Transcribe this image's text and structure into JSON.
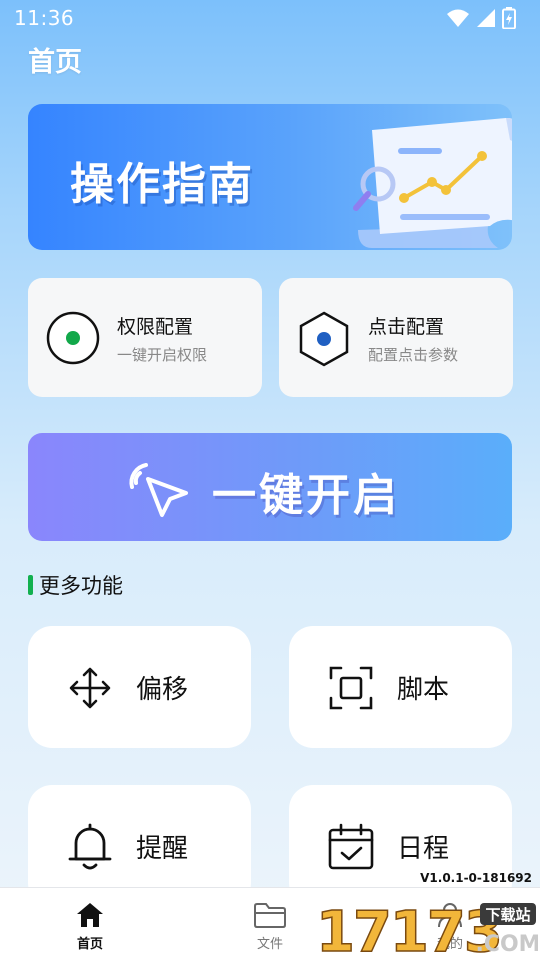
{
  "status_bar": {
    "time": "11:36"
  },
  "page_title": "首页",
  "guide_banner": {
    "title": "操作指南"
  },
  "config_cards": [
    {
      "title": "权限配置",
      "subtitle": "一键开启权限",
      "icon": "radio-dot-icon",
      "accent": "#12a84a"
    },
    {
      "title": "点击配置",
      "subtitle": "配置点击参数",
      "icon": "hexagon-dot-icon",
      "accent": "#1f5fc2"
    }
  ],
  "onekey_banner": {
    "label": "一键开启"
  },
  "more_section": {
    "title": "更多功能"
  },
  "features": [
    {
      "label": "偏移",
      "icon": "move-arrows-icon"
    },
    {
      "label": "脚本",
      "icon": "frame-square-icon"
    },
    {
      "label": "提醒",
      "icon": "bell-icon"
    },
    {
      "label": "日程",
      "icon": "calendar-check-icon"
    }
  ],
  "version": "V1.0.1-0-181692",
  "bottom_nav": {
    "tabs": [
      {
        "label": "首页",
        "icon": "home-icon",
        "active": true
      },
      {
        "label": "文件",
        "icon": "folder-icon",
        "active": false
      },
      {
        "label": "我的",
        "icon": "user-icon",
        "active": false
      }
    ]
  },
  "watermark": {
    "text": "17173",
    "badge": "下载站",
    "suffix": ".COM"
  },
  "colors": {
    "accent_green": "#12b04f",
    "banner_blue": "#3584ff",
    "banner_purple": "#8a86fc"
  }
}
